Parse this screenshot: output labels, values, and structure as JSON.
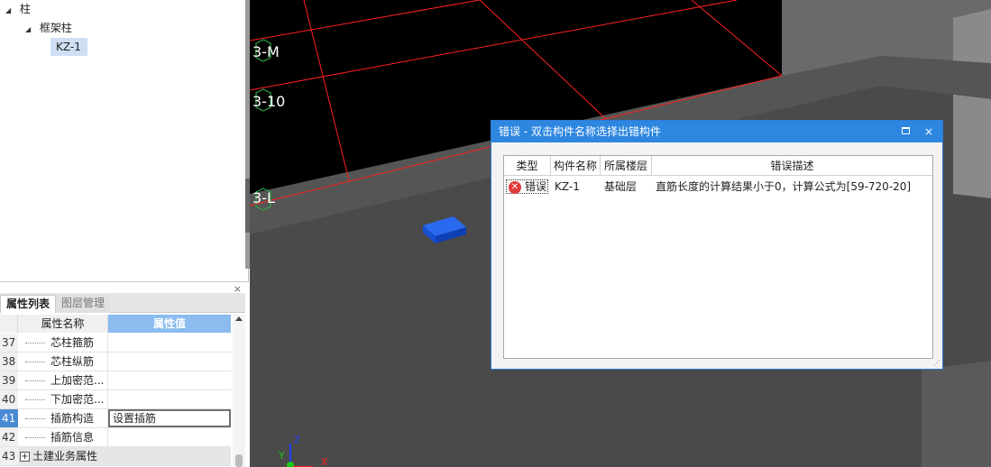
{
  "tree": {
    "root_label": "柱",
    "child_label": "框架柱",
    "leaf_label": "KZ-1"
  },
  "props_panel": {
    "close_label": "×",
    "tabs": [
      {
        "label": "属性列表"
      },
      {
        "label": "图层管理"
      }
    ],
    "headers": {
      "name": "属性名称",
      "value": "属性值"
    },
    "rows": [
      {
        "num": "37",
        "name": "芯柱箍筋",
        "value": ""
      },
      {
        "num": "38",
        "name": "芯柱纵筋",
        "value": ""
      },
      {
        "num": "39",
        "name": "上加密范...",
        "value": ""
      },
      {
        "num": "40",
        "name": "下加密范...",
        "value": ""
      },
      {
        "num": "41",
        "name": "插筋构造",
        "value": "设置插筋"
      },
      {
        "num": "42",
        "name": "插筋信息",
        "value": ""
      },
      {
        "num": "43",
        "name": "土建业务属性",
        "value": ""
      }
    ],
    "selected_row": "41",
    "group_expand_symbol": "+"
  },
  "viewport": {
    "axis_labels": [
      "3-M",
      "3-10",
      "3-L"
    ],
    "coord_axes": {
      "x": "X",
      "y": "Y",
      "z": "Z"
    },
    "colors": {
      "background_black": "#000000",
      "grid_red": "#ff2020",
      "floor_gray": "#4a4a4a",
      "block_blue": "#1650d8"
    }
  },
  "dialog": {
    "title": "错误 - 双击构件名称选择出错构件",
    "close_label": "×",
    "columns": [
      "类型",
      "构件名称",
      "所属楼层",
      "错误描述"
    ],
    "rows": [
      {
        "type": "错误",
        "component": "KZ-1",
        "floor": "基础层",
        "description": "直筋长度的计算结果小于0，计算公式为[59-720-20]"
      }
    ],
    "error_icon": "✕"
  }
}
